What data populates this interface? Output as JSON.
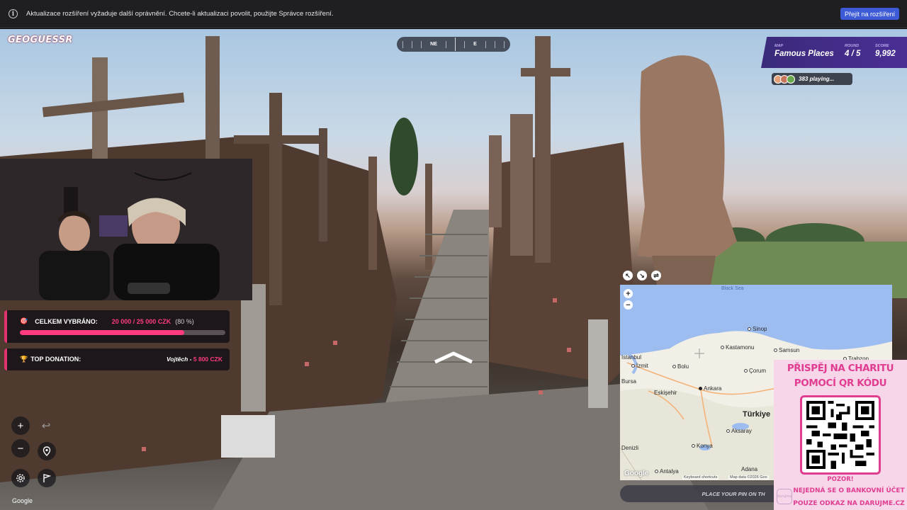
{
  "ext_bar": {
    "message": "Aktualizace rozšíření vyžaduje další oprávnění. Chcete-li aktualizaci povolit, použijte Správce rozšíření.",
    "button": "Přejít na rozšíření"
  },
  "logo": "GEOGUESSR",
  "compass": {
    "left": "NE",
    "right": "E"
  },
  "game": {
    "map_label": "MAP",
    "map_value": "Famous Places",
    "round_label": "ROUND",
    "round_value": "4 / 5",
    "score_label": "SCORE",
    "score_value": "9,992",
    "playing": "383 playing..."
  },
  "donation": {
    "total_label": "CELKEM VYBRÁNO:",
    "total_amount": "20 000 / 25 000 CZK",
    "total_percent": "(80 %)",
    "progress": 0.8,
    "top_label": "TOP DONATION:",
    "top_name": "Vojtěch -",
    "top_amount": "5 800 CZK"
  },
  "controls": {
    "zoom_in": "+",
    "zoom_out": "−",
    "google": "Google"
  },
  "map": {
    "labels": {
      "sea": "Black Sea",
      "sinop": "Sinop",
      "kastamonu": "Kastamonu",
      "samsun": "Samsun",
      "trabzon": "Trabzon",
      "istanbul": "Istanbul",
      "izmit": "İzmit",
      "bolu": "Bolu",
      "corum": "Çorum",
      "bursa": "Bursa",
      "eskisehir": "Eskişehir",
      "ankara": "Ankara",
      "turkiye": "Türkiye",
      "aksaray": "Aksaray",
      "denizli": "Denizli",
      "konya": "Konya",
      "antalya": "Antalya",
      "adana": "Adana"
    },
    "google": "Google",
    "shortcuts": "Keyboard shortcuts",
    "attribution": "Map data ©2026 Goo",
    "place_pin": "PLACE YOUR PIN ON TH"
  },
  "charity": {
    "line1": "PŘISPĚJ NA CHARITU",
    "line2": "POMOCÍ QR KÓDU",
    "line3": "POZOR!",
    "line4": "NEJEDNÁ SE O BANKOVNÍ ÚČET",
    "line5": "POUZE ODKAZ NA DARUJME.CZ",
    "badge": "darujme"
  },
  "colors": {
    "accent": "#ff3b80",
    "panel": "#4a2f95",
    "charity": "#e03d91",
    "button": "#3d5bd6"
  }
}
